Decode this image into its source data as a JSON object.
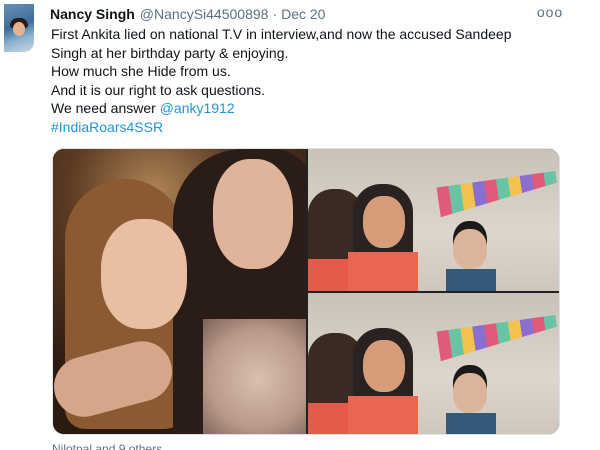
{
  "tweet": {
    "author_name": "Nancy Singh",
    "author_handle": "@NancySi44500898",
    "separator": "·",
    "date": "Dec 20",
    "more_icon": "ooo",
    "lines": [
      "First Ankita lied on national T.V in interview,and now the accused Sandeep",
      "Singh at her birthday party & enjoying.",
      "How much she Hide from us.",
      "And it is our right to ask questions."
    ],
    "mention_prefix": "We need answer ",
    "mention": "@anky1912",
    "hashtag": "#IndiaRoars4SSR",
    "footer_text": "Nilotpal and 9 others"
  },
  "icons": {
    "avatar": "profile-photo",
    "more": "more-horizontal-icon"
  },
  "colors": {
    "link": "#1b95e0",
    "secondary_text": "#5b7083",
    "primary_text": "#0f1419"
  }
}
